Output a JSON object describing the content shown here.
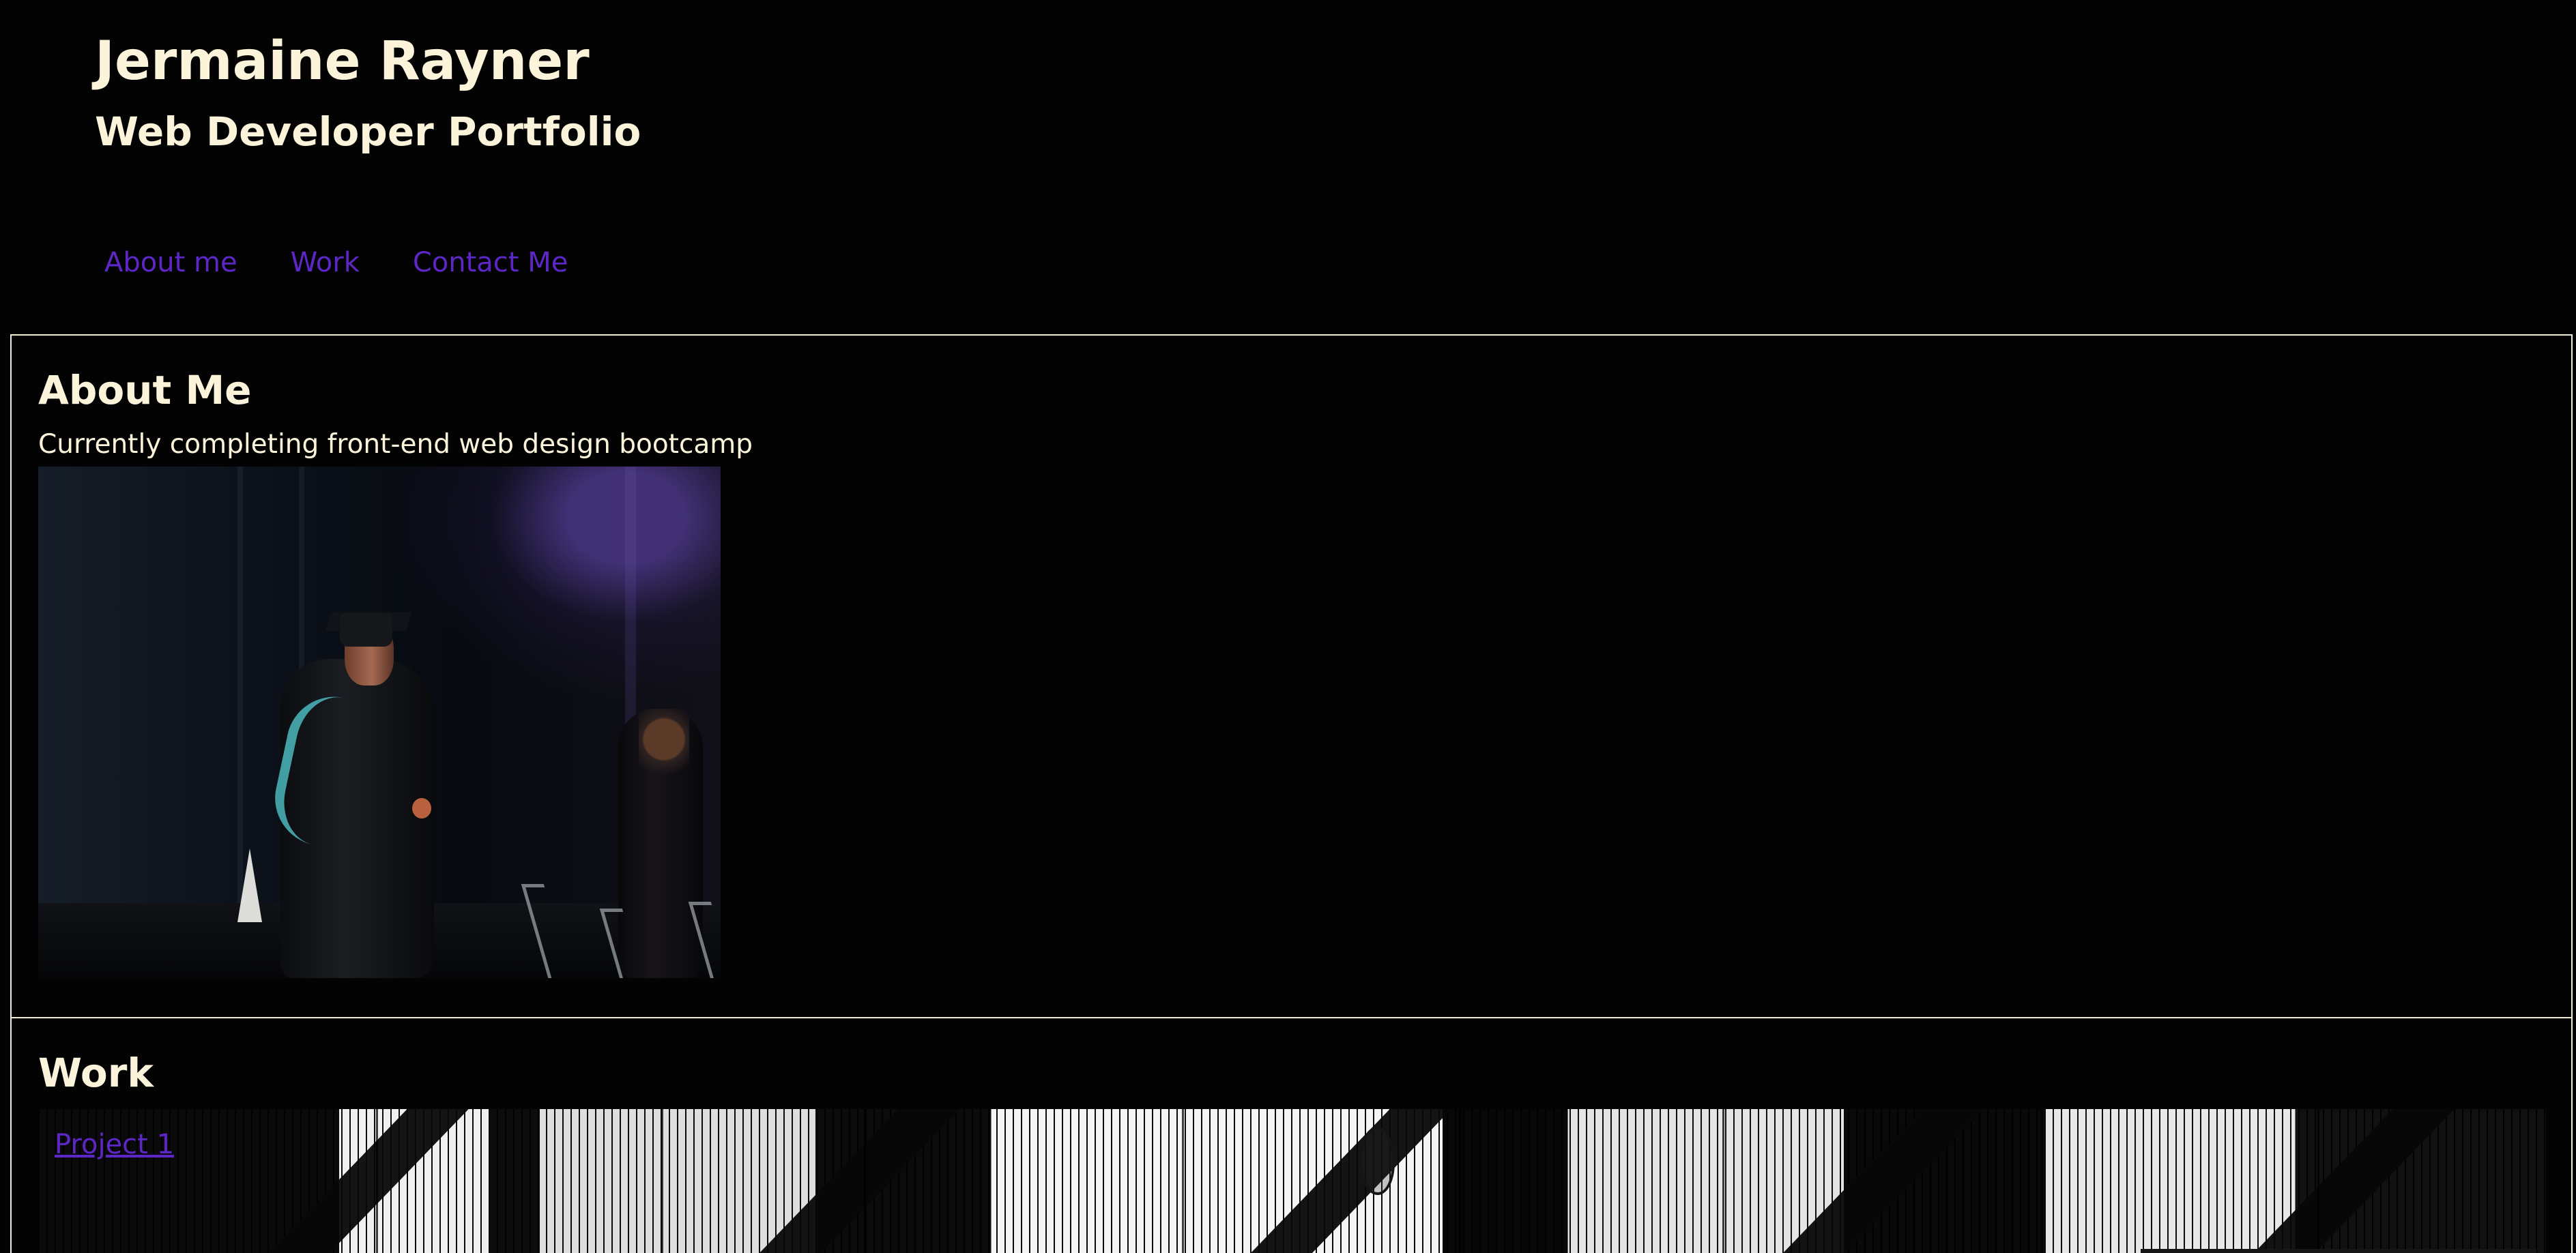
{
  "header": {
    "name": "Jermaine Rayner",
    "subtitle": "Web Developer Portfolio"
  },
  "navigation": {
    "items": [
      {
        "label": "About me"
      },
      {
        "label": "Work"
      },
      {
        "label": "Contact Me"
      }
    ]
  },
  "about": {
    "title": "About Me",
    "text": "Currently completing front-end web design bootcamp"
  },
  "work": {
    "title": "Work",
    "projects": [
      {
        "label": "Project 1"
      }
    ]
  },
  "colors": {
    "background": "#030303",
    "text": "#fbf3da",
    "link": "#5d26c7",
    "border": "#f0ecd8"
  }
}
